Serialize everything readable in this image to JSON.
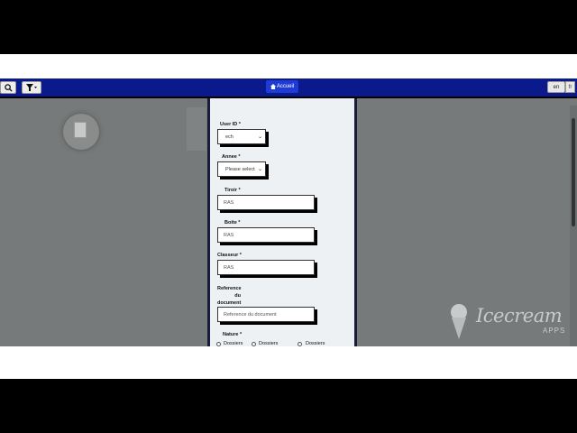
{
  "topbar": {
    "home_label": "Accueil",
    "lang_label": "en",
    "right_label": "fr"
  },
  "form": {
    "user_id": {
      "label": "User ID *",
      "value": "ech"
    },
    "annee": {
      "label": "Annee *",
      "value": "Please select"
    },
    "tiroir": {
      "label": "Tiroir *",
      "value": "RAS"
    },
    "boite": {
      "label": "Boite *",
      "value": "RAS"
    },
    "classeur": {
      "label": "Classeur *",
      "value": "RAS"
    },
    "reference": {
      "label_line1": "Reference",
      "label_line2": "du",
      "label_line3": "document *",
      "placeholder": "Reference du document"
    },
    "nature": {
      "label": "Nature *",
      "options": [
        "Dossiers",
        "Dossiers",
        "Dossiers"
      ]
    }
  },
  "watermark": {
    "text": "Icecream",
    "sub": "APPS"
  },
  "colors": {
    "topbar": "#0a1a8c",
    "accent": "#1f3bd6",
    "panel": "#eef1f3",
    "overlay": "#777a7a"
  },
  "icons": [
    "search-icon",
    "filter-icon",
    "home-icon",
    "document-icon",
    "chevron-down-icon"
  ]
}
